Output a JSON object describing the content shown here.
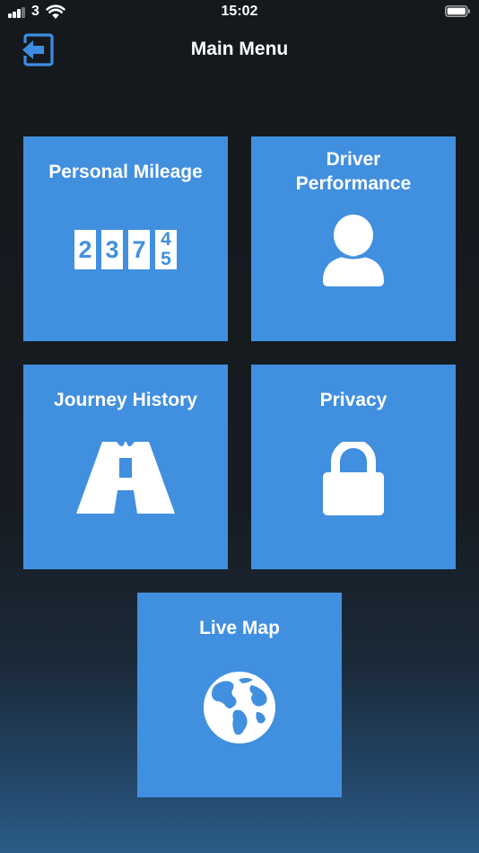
{
  "status": {
    "carrier": "3",
    "time": "15:02"
  },
  "header": {
    "title": "Main Menu"
  },
  "tiles": [
    {
      "label": "Personal Mileage",
      "odometer": [
        "2",
        "3",
        "7"
      ],
      "odometer_rolling": [
        "4",
        "5"
      ]
    },
    {
      "label": "Driver\nPerformance"
    },
    {
      "label": "Journey History"
    },
    {
      "label": "Privacy"
    },
    {
      "label": "Live Map"
    }
  ],
  "colors": {
    "tile": "#418fdf",
    "background": "#161a1e",
    "accent": "#418fdf"
  },
  "icons": [
    "back-arrow-icon",
    "odometer-icon",
    "person-icon",
    "road-icon",
    "lock-icon",
    "globe-icon"
  ]
}
